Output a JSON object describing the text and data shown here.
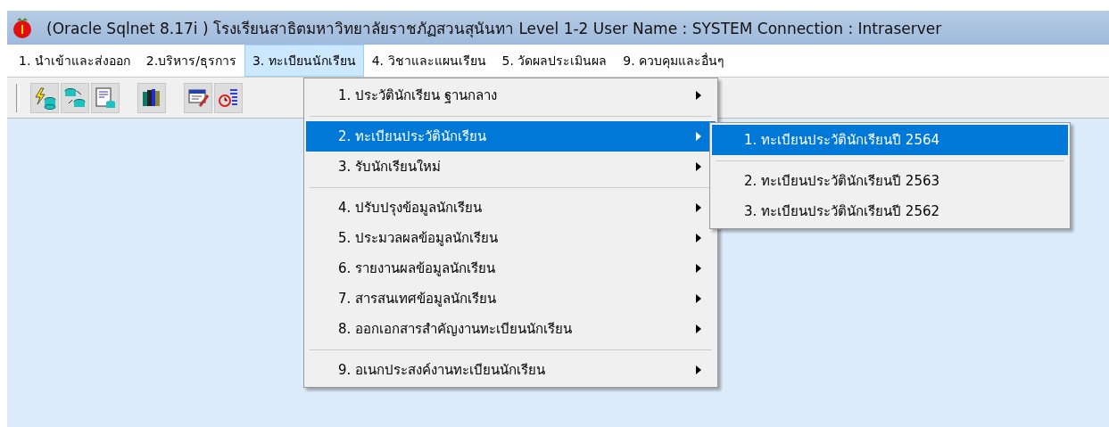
{
  "window": {
    "title": "(Oracle Sqlnet 8.17i ) โรงเรียนสาธิตมหาวิทยาลัยราชภัฏสวนสุนันทา  Level 1-2  User Name :  SYSTEM  Connection : Intraserver"
  },
  "menu_bar": [
    {
      "label": "1. นำเข้าและส่งออก",
      "selected": false
    },
    {
      "label": "2.บริหาร/ธุรการ",
      "selected": false
    },
    {
      "label": "3. ทะเบียนนักเรียน",
      "selected": true
    },
    {
      "label": "4. วิชาและแผนเรียน",
      "selected": false
    },
    {
      "label": "5. วัดผลประเมินผล",
      "selected": false
    },
    {
      "label": "9. ควบคุมและอื่นๆ",
      "selected": false
    }
  ],
  "dropdown_menu": [
    {
      "kind": "item",
      "label": "1. ประวัตินักเรียน ฐานกลาง",
      "selected": false,
      "has_submenu": true
    },
    {
      "kind": "separator"
    },
    {
      "kind": "item",
      "label": "2. ทะเบียนประวัตินักเรียน",
      "selected": true,
      "has_submenu": true
    },
    {
      "kind": "item",
      "label": "3. รับนักเรียนใหม่",
      "selected": false,
      "has_submenu": true
    },
    {
      "kind": "separator"
    },
    {
      "kind": "item",
      "label": "4. ปรับปรุงข้อมูลนักเรียน",
      "selected": false,
      "has_submenu": true
    },
    {
      "kind": "item",
      "label": "5. ประมวลผลข้อมูลนักเรียน",
      "selected": false,
      "has_submenu": true
    },
    {
      "kind": "item",
      "label": "6. รายงานผลข้อมูลนักเรียน",
      "selected": false,
      "has_submenu": true
    },
    {
      "kind": "item",
      "label": "7. สารสนเทศข้อมูลนักเรียน",
      "selected": false,
      "has_submenu": true
    },
    {
      "kind": "item",
      "label": "8. ออกเอกสารสำคัญงานทะเบียนนักเรียน",
      "selected": false,
      "has_submenu": true
    },
    {
      "kind": "separator"
    },
    {
      "kind": "item",
      "label": "9. อเนกประสงค์งานทะเบียนนักเรียน",
      "selected": false,
      "has_submenu": true
    }
  ],
  "submenu": [
    {
      "kind": "item",
      "label": "1. ทะเบียนประวัตินักเรียนปี 2564",
      "selected": true,
      "has_submenu": false
    },
    {
      "kind": "separator"
    },
    {
      "kind": "item",
      "label": "2. ทะเบียนประวัตินักเรียนปี 2563",
      "selected": false,
      "has_submenu": false
    },
    {
      "kind": "item",
      "label": "3. ทะเบียนประวัตินักเรียนปี 2562",
      "selected": false,
      "has_submenu": false
    }
  ]
}
